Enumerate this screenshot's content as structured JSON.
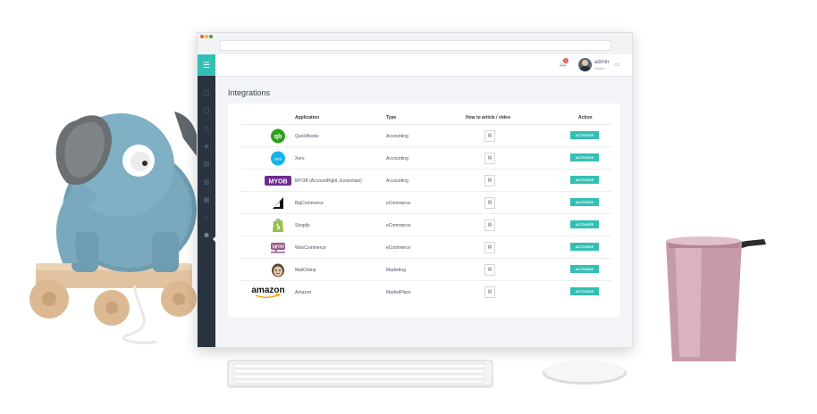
{
  "topbar": {
    "notification_count": "1",
    "user_name": "admin",
    "user_role": "Admin"
  },
  "page": {
    "title": "Integrations"
  },
  "table": {
    "headers": {
      "application": "Application",
      "type": "Type",
      "how_to": "How to article / video",
      "action": "Action"
    },
    "rows": [
      {
        "application": "QuickBooks",
        "type": "Accounting",
        "action": "ACTIVATE",
        "logo_icon": "quickbooks-logo",
        "logo_color": "#2ca01c"
      },
      {
        "application": "Xero",
        "type": "Accounting",
        "action": "ACTIVATE",
        "logo_icon": "xero-logo",
        "logo_color": "#13b5ea"
      },
      {
        "application": "MYOB (AccountRight, Essentials)",
        "type": "Accounting",
        "action": "ACTIVATE",
        "logo_icon": "myob-logo",
        "logo_color": "#6e2c8e"
      },
      {
        "application": "BigCommerce",
        "type": "eCommerce",
        "action": "ACTIVATE",
        "logo_icon": "bigcommerce-logo",
        "logo_color": "#121118"
      },
      {
        "application": "Shopify",
        "type": "eCommerce",
        "action": "ACTIVATE",
        "logo_icon": "shopify-logo",
        "logo_color": "#95bf47"
      },
      {
        "application": "WooCommerce",
        "type": "eCommerce",
        "action": "ACTIVATE",
        "logo_icon": "woocommerce-logo",
        "logo_color": "#96588a"
      },
      {
        "application": "MailChimp",
        "type": "Marketing",
        "action": "ACTIVATE",
        "logo_icon": "mailchimp-logo",
        "logo_color": "#241c15"
      },
      {
        "application": "Amazon",
        "type": "MarketPlace",
        "action": "ACTIVATE",
        "logo_icon": "amazon-logo",
        "logo_color": "#ff9900"
      }
    ]
  },
  "logos": {
    "quickbooks": "qb",
    "xero": "xero",
    "myob": "MYOB",
    "amazon": "amazon"
  },
  "colors": {
    "accent": "#33c0b4",
    "sidebar": "#2a3441"
  }
}
